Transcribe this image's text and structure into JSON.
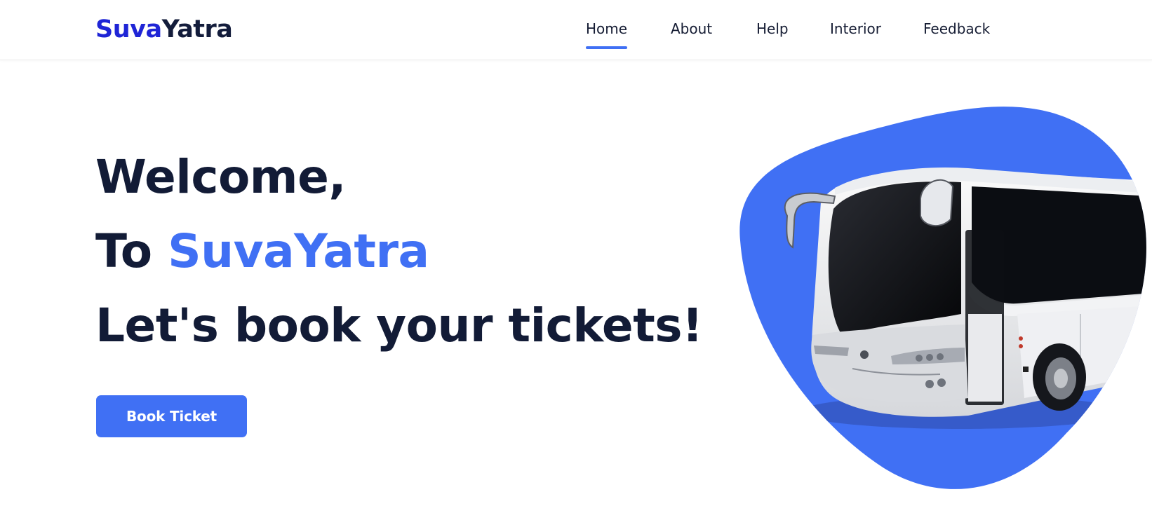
{
  "brand": {
    "part1": "Suva",
    "part2": "Yatra",
    "color_primary": "#1f25d6",
    "color_dark": "#131c3b"
  },
  "nav": {
    "items": [
      {
        "label": "Home",
        "active": true
      },
      {
        "label": "About",
        "active": false
      },
      {
        "label": "Help",
        "active": false
      },
      {
        "label": "Interior",
        "active": false
      },
      {
        "label": "Feedback",
        "active": false
      }
    ],
    "active_color": "#4070f4"
  },
  "hero": {
    "line1": "Welcome,",
    "line2_prefix": "To ",
    "line2_brand": "SuvaYatra",
    "line3": "Let's book your tickets!",
    "accent_color": "#4070f4"
  },
  "cta": {
    "label": "Book Ticket",
    "color": "#4070f4"
  },
  "illustration": {
    "icon": "bus-image",
    "blob_color": "#4070f4"
  }
}
